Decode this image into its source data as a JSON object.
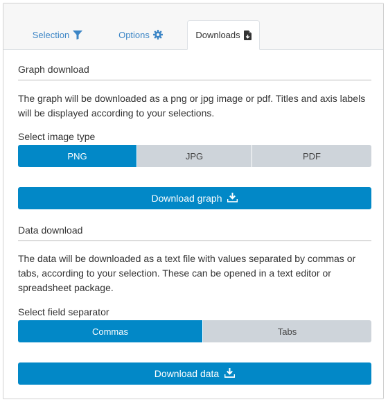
{
  "tabs": [
    {
      "label": "Selection",
      "icon": "filter-icon",
      "active": false
    },
    {
      "label": "Options",
      "icon": "gear-icon",
      "active": false
    },
    {
      "label": "Downloads",
      "icon": "file-download-icon",
      "active": true
    }
  ],
  "graph": {
    "title": "Graph download",
    "description": "The graph will be downloaded as a png or jpg image or pdf. Titles and axis labels will be displayed according to your selections.",
    "select_label": "Select image type",
    "options": [
      "PNG",
      "JPG",
      "PDF"
    ],
    "selected": "PNG",
    "button_label": "Download graph",
    "button_icon": "download-icon"
  },
  "data": {
    "title": "Data download",
    "description": "The data will be downloaded as a text file with values separated by commas or tabs, according to your selection. These can be opened in a text editor or spreadsheet package.",
    "select_label": "Select field separator",
    "options": [
      "Commas",
      "Tabs"
    ],
    "selected": "Commas",
    "button_label": "Download data",
    "button_icon": "download-icon"
  },
  "colors": {
    "accent": "#0288c7",
    "tab_link": "#3d86c6",
    "unselected": "#ced4da"
  }
}
